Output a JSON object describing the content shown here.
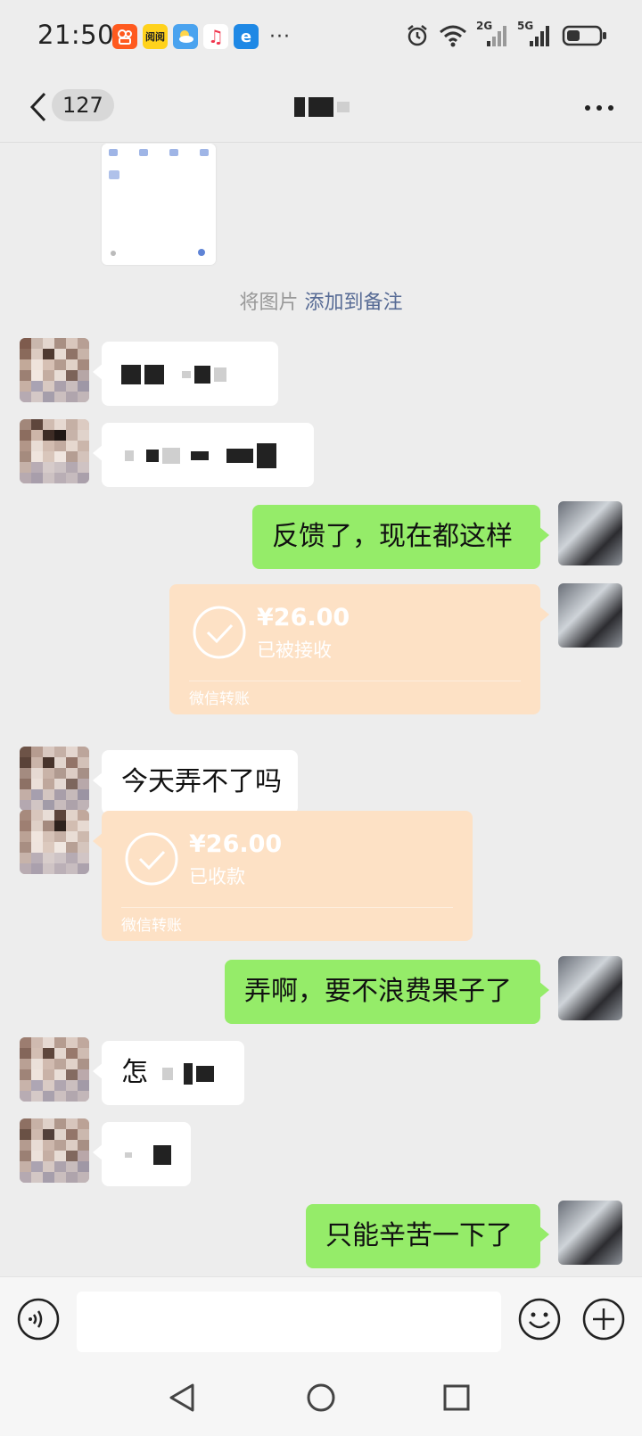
{
  "status_bar": {
    "time": "21:50",
    "app_icons": [
      {
        "name": "kuaishou-icon",
        "glyph": "",
        "bg": "#ff5a1f"
      },
      {
        "name": "reading-app-icon",
        "glyph": "阅阅",
        "bg": "#ffd21c"
      },
      {
        "name": "weather-icon",
        "glyph": "",
        "bg": "#4aa3ef"
      },
      {
        "name": "music-icon",
        "glyph": "♫",
        "bg": "#ffffff"
      },
      {
        "name": "browser-icon",
        "glyph": "e",
        "bg": "#1e88e5"
      }
    ],
    "more": "···",
    "network_2g": "2G",
    "network_5g": "5G"
  },
  "nav": {
    "unread_count": "127",
    "more": "···"
  },
  "chat": {
    "system_note_prefix": "将图片",
    "system_note_link": "添加到备注",
    "messages": [
      {
        "side": "left",
        "kind": "censored"
      },
      {
        "side": "left",
        "kind": "censored"
      },
      {
        "side": "right",
        "kind": "text",
        "text": "反馈了，现在都这样"
      },
      {
        "side": "right",
        "kind": "transfer",
        "amount": "¥26.00",
        "status": "已被接收",
        "label": "微信转账"
      },
      {
        "side": "left",
        "kind": "text",
        "text": "今天弄不了吗"
      },
      {
        "side": "left",
        "kind": "transfer",
        "amount": "¥26.00",
        "status": "已收款",
        "label": "微信转账"
      },
      {
        "side": "right",
        "kind": "text",
        "text": "弄啊，要不浪费果子了"
      },
      {
        "side": "left",
        "kind": "partial",
        "text": "怎"
      },
      {
        "side": "left",
        "kind": "censored"
      },
      {
        "side": "right",
        "kind": "text",
        "text": "只能辛苦一下了"
      }
    ]
  },
  "colors": {
    "bg": "#ededed",
    "green_bubble": "#95ec69",
    "transfer_bg": "#fde1c5",
    "link": "#576b95"
  }
}
